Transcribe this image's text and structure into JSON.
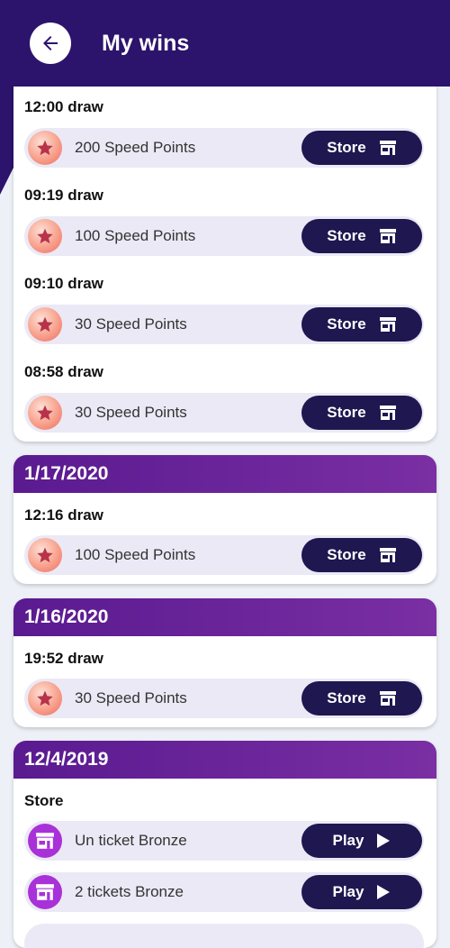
{
  "header": {
    "title": "My wins",
    "back_icon": "arrow-left-icon"
  },
  "colors": {
    "header_bg": "#2c136c",
    "card_header": "#6a22a0",
    "button_bg": "#1f1750",
    "row_bg": "#ebe9f5"
  },
  "card0": {
    "groups": [
      {
        "label": "12:00 draw",
        "item": "200 Speed Points",
        "button": "Store"
      },
      {
        "label": "09:19 draw",
        "item": "100 Speed Points",
        "button": "Store"
      },
      {
        "label": "09:10 draw",
        "item": "30 Speed Points",
        "button": "Store"
      },
      {
        "label": "08:58 draw",
        "item": "30 Speed Points",
        "button": "Store"
      }
    ]
  },
  "card1": {
    "date": "1/17/2020",
    "groups": [
      {
        "label": "12:16 draw",
        "item": "100 Speed Points",
        "button": "Store"
      }
    ]
  },
  "card2": {
    "date": "1/16/2020",
    "groups": [
      {
        "label": "19:52 draw",
        "item": "30 Speed Points",
        "button": "Store"
      }
    ]
  },
  "card3": {
    "date": "12/4/2019",
    "label": "Store",
    "items": [
      {
        "item": "Un ticket Bronze",
        "button": "Play"
      },
      {
        "item": "2 tickets Bronze",
        "button": "Play"
      }
    ]
  }
}
